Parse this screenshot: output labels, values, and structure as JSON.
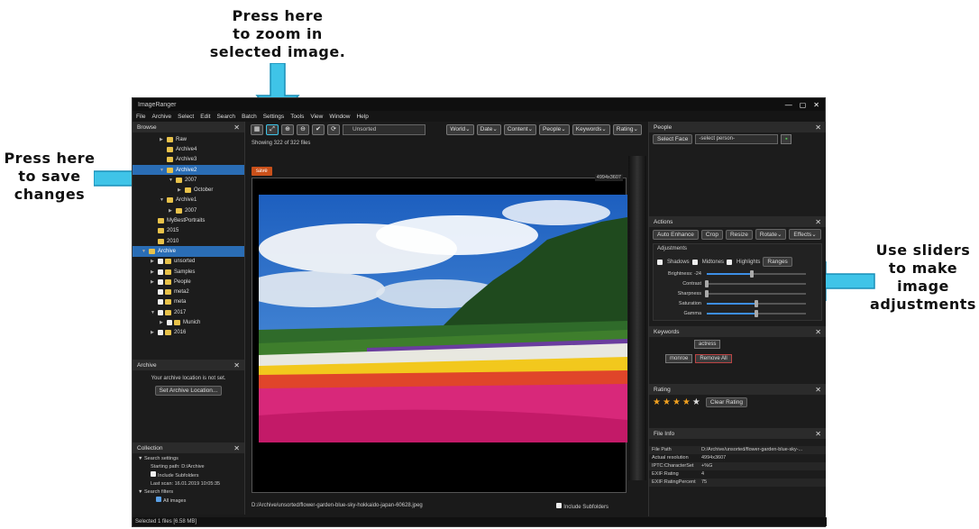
{
  "annotations": {
    "zoom": [
      "Press here",
      "to zoom in",
      "selected image."
    ],
    "save": [
      "Press here",
      "to save",
      "changes"
    ],
    "sliders": [
      "Use sliders",
      "to make",
      "image",
      "adjustments"
    ]
  },
  "colors": {
    "accent": "#2a6db5",
    "save": "#c9501a",
    "arrow": "#3fc4e8",
    "star": "#f0a020"
  },
  "window": {
    "title": "ImageRanger",
    "controls": [
      "—",
      "▢",
      "✕"
    ]
  },
  "menu": [
    "File",
    "Archive",
    "Select",
    "Edit",
    "Search",
    "Batch",
    "Settings",
    "Tools",
    "View",
    "Window",
    "Help"
  ],
  "browse": {
    "title": "Browse",
    "tree": [
      {
        "label": "Raw",
        "indent": 3,
        "type": "folder",
        "caret": "▶"
      },
      {
        "label": "Archive4",
        "indent": 3,
        "type": "folder",
        "caret": ""
      },
      {
        "label": "Archive3",
        "indent": 3,
        "type": "folder",
        "caret": ""
      },
      {
        "label": "Archive2",
        "indent": 3,
        "type": "folder",
        "caret": "▼",
        "selected": true
      },
      {
        "label": "2007",
        "indent": 4,
        "type": "folder",
        "caret": "▼"
      },
      {
        "label": "October",
        "indent": 5,
        "type": "folder",
        "caret": "▶"
      },
      {
        "label": "Archive1",
        "indent": 3,
        "type": "folder",
        "caret": "▼"
      },
      {
        "label": "2007",
        "indent": 4,
        "type": "folder",
        "caret": "▶"
      },
      {
        "label": "MyBestPortraits",
        "indent": 2,
        "type": "folder",
        "caret": ""
      },
      {
        "label": "2015",
        "indent": 2,
        "type": "folder",
        "caret": ""
      },
      {
        "label": "2010",
        "indent": 2,
        "type": "folder",
        "caret": ""
      },
      {
        "label": "Archive",
        "indent": 1,
        "type": "folder",
        "caret": "▼",
        "selected": true
      },
      {
        "label": "unsorted",
        "indent": 2,
        "type": "check",
        "caret": "▶"
      },
      {
        "label": "Samples",
        "indent": 2,
        "type": "check",
        "caret": "▶"
      },
      {
        "label": "People",
        "indent": 2,
        "type": "check",
        "caret": "▶"
      },
      {
        "label": "meta2",
        "indent": 2,
        "type": "check",
        "caret": ""
      },
      {
        "label": "meta",
        "indent": 2,
        "type": "check",
        "caret": ""
      },
      {
        "label": "2017",
        "indent": 2,
        "type": "check",
        "caret": "▼"
      },
      {
        "label": "Munich",
        "indent": 3,
        "type": "check",
        "caret": "▶"
      },
      {
        "label": "2016",
        "indent": 2,
        "type": "check",
        "caret": "▶"
      }
    ]
  },
  "archive": {
    "title": "Archive",
    "message": "Your archive location is not set.",
    "button": "Set Archive Location..."
  },
  "collection": {
    "title": "Collection",
    "lines": [
      "Search settings",
      "Starting path: D:/Archive",
      "Include Subfolders",
      "Last scan: 16.01.2019 10:05:35",
      "Search filters",
      "All images"
    ]
  },
  "status": "Selected 1 files [6.58 MB]",
  "toolbar": {
    "icons": [
      "▦",
      "⤢",
      "⊕",
      "⊖",
      "✔",
      "⟳"
    ],
    "unsorted": "Unsorted",
    "filters": [
      "World",
      "Date",
      "Content",
      "People",
      "Keywords",
      "Rating"
    ]
  },
  "viewer": {
    "showing": "Showing 322 of 322 files",
    "save": "save",
    "dimensions": "4994x3607",
    "path": "D:/Archive/unsorted/flower-garden-blue-sky-hokkaido-japan-60628.jpeg",
    "include_subfolders": "Include Subfolders"
  },
  "people": {
    "title": "People",
    "select_face": "Select Face",
    "select_person": "-select person-"
  },
  "actions": {
    "title": "Actions",
    "buttons": [
      "Auto Enhance",
      "Crop",
      "Resize",
      "Rotate",
      "Effects"
    ],
    "adjustments_title": "Adjustments",
    "toggles": [
      "Shadows",
      "Midtones",
      "Highlights"
    ],
    "ranges": "Ranges",
    "sliders": [
      {
        "label": "Brightness: -24",
        "value": 0.45
      },
      {
        "label": "Contrast",
        "value": 0.0
      },
      {
        "label": "Sharpness",
        "value": 0.0
      },
      {
        "label": "Saturation",
        "value": 0.5
      },
      {
        "label": "Gamma",
        "value": 0.5
      }
    ]
  },
  "keywords": {
    "title": "Keywords",
    "tags": [
      "actress",
      "monroe"
    ],
    "remove_all": "Remove All"
  },
  "rating": {
    "title": "Rating",
    "value": 4,
    "max": 5,
    "clear": "Clear Rating"
  },
  "fileinfo": {
    "title": "File Info",
    "rows": [
      {
        "k": "File Path",
        "v": "D:/Archive/unsorted/flower-garden-blue-sky-..."
      },
      {
        "k": "Actual resolution",
        "v": "4994x3607"
      },
      {
        "k": "IPTC:CharacterSet",
        "v": "+%G"
      },
      {
        "k": "EXIF:Rating",
        "v": "4"
      },
      {
        "k": "EXIF:RatingPercent",
        "v": "75"
      }
    ]
  }
}
